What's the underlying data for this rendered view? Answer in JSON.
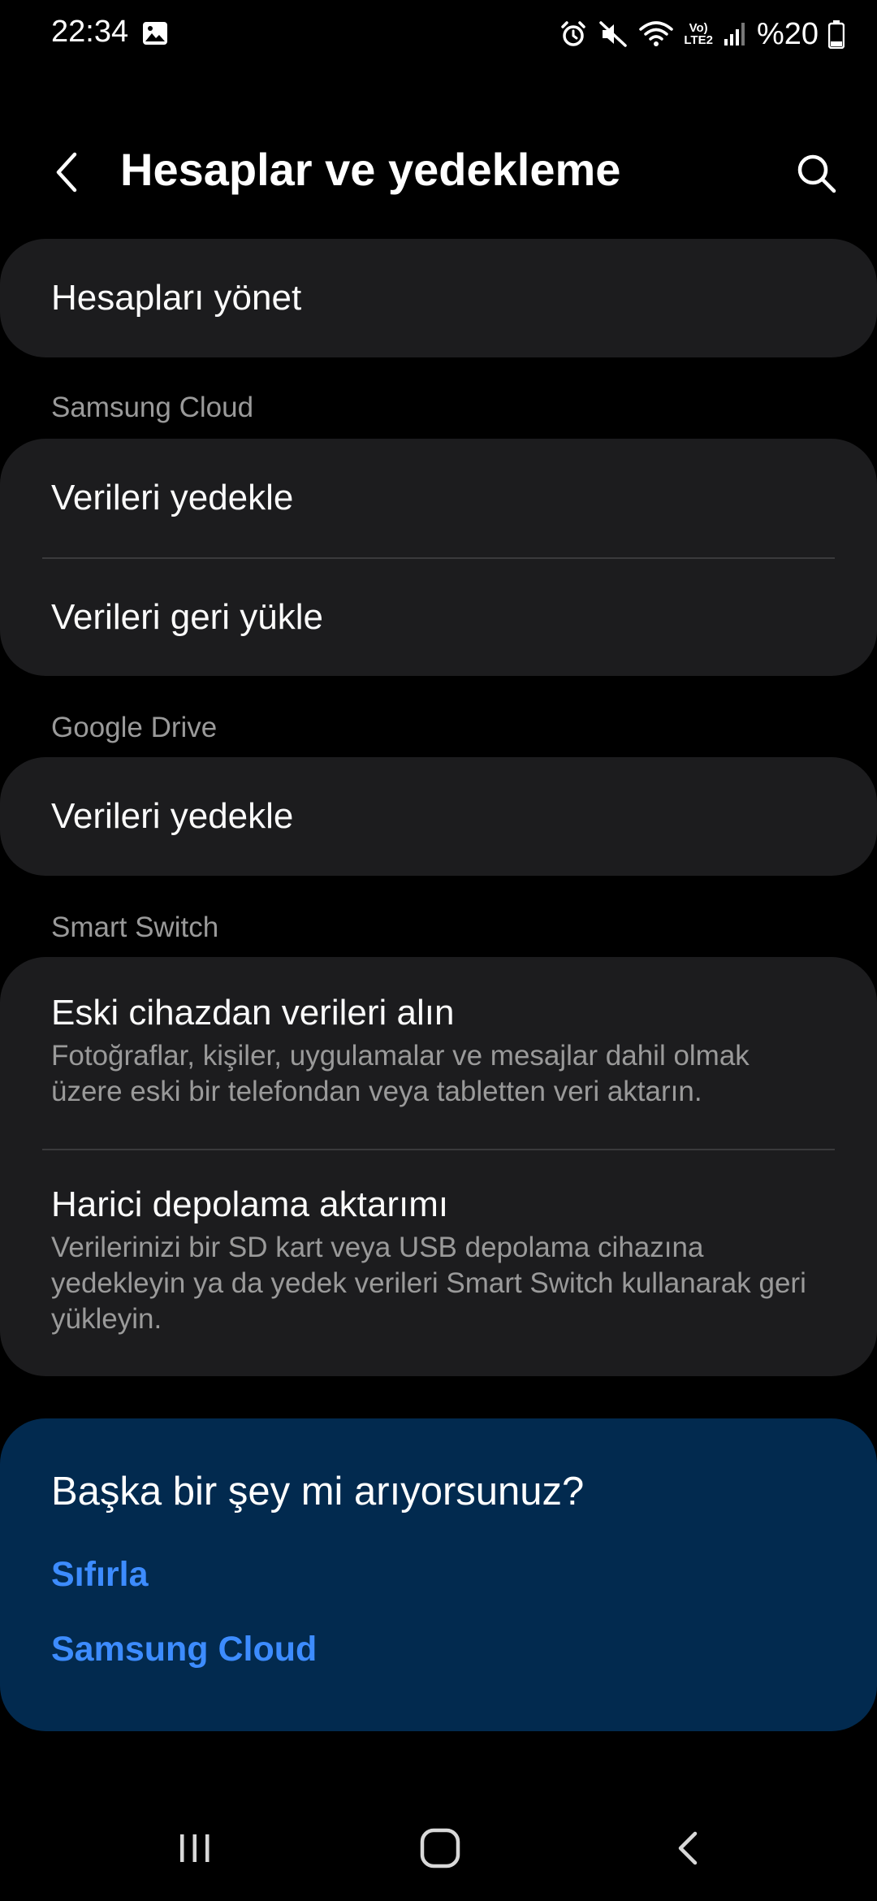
{
  "status_bar": {
    "time": "22:34",
    "volte_top": "Vo)",
    "volte_bottom": "LTE2",
    "battery_text": "%20",
    "icons": [
      "gallery-icon",
      "alarm-icon",
      "mute-icon",
      "wifi-icon",
      "signal-icon",
      "battery-icon"
    ]
  },
  "app_bar": {
    "title": "Hesaplar ve yedekleme",
    "back_icon": "back-chevron-icon",
    "search_icon": "search-icon"
  },
  "manage": {
    "label": "Hesapları yönet"
  },
  "samsung_cloud": {
    "header": "Samsung Cloud",
    "items": [
      {
        "title": "Verileri yedekle"
      },
      {
        "title": "Verileri geri yükle"
      }
    ]
  },
  "google_drive": {
    "header": "Google Drive",
    "items": [
      {
        "title": "Verileri yedekle"
      }
    ]
  },
  "smart_switch": {
    "header": "Smart Switch",
    "items": [
      {
        "title": "Eski cihazdan verileri alın",
        "subtitle": "Fotoğraflar, kişiler, uygulamalar ve mesajlar dahil olmak üzere eski bir telefondan veya tabletten veri aktarın."
      },
      {
        "title": "Harici depolama aktarımı",
        "subtitle": "Verilerinizi bir SD kart veya USB depolama cihazına yedekleyin ya da yedek verileri Smart Switch kullanarak geri yükleyin."
      }
    ]
  },
  "suggestions": {
    "title": "Başka bir şey mi arıyorsunuz?",
    "links": [
      "Sıfırla",
      "Samsung Cloud"
    ]
  },
  "nav_bar": {
    "icons": [
      "recents-icon",
      "home-icon",
      "back-icon"
    ]
  },
  "colors": {
    "background": "#000000",
    "card": "#1c1c1e",
    "suggest_card": "#022a4f",
    "link": "#3d8cff",
    "secondary_text": "#9a9a9a"
  }
}
